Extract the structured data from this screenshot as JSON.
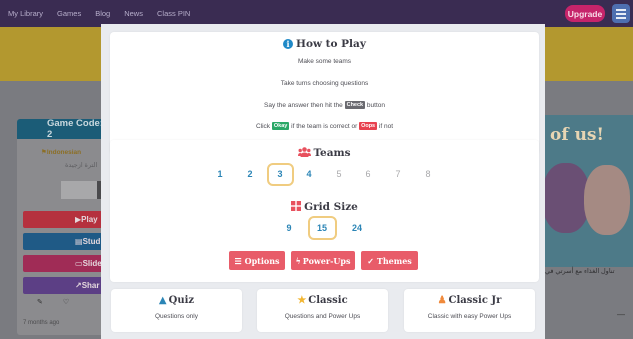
{
  "bg": {
    "nav_links": [
      "My Library",
      "Games",
      "Blog",
      "News",
      "Class PIN"
    ],
    "upgrade": "Upgrade",
    "card": {
      "title": "Game Code: 2",
      "lang": "Indonesian",
      "arabic": "الترة ازجيدة",
      "buttons": [
        {
          "label": "Play",
          "color": "#b5313e"
        },
        {
          "label": "Stud",
          "color": "#1f5a86"
        },
        {
          "label": "Slides",
          "color": "#a02c56"
        },
        {
          "label": "Shar",
          "color": "#5c3f85"
        }
      ],
      "time": "7 months ago"
    },
    "promo_text": "of us!",
    "promo_arabic": "تناول الغذاء مع أسرتي في"
  },
  "how_to_play": {
    "title": "How to Play",
    "line1": "Make some teams",
    "line2": "Take turns choosing questions",
    "line3_pre": "Say the answer then hit the",
    "check_tag": "Check",
    "line3_post": "button",
    "line4_pre": "Click",
    "okay_tag": "Okay",
    "line4_mid": "if the team is correct or",
    "oops_tag": "Oops",
    "line4_post": "if not"
  },
  "teams": {
    "title": "Teams",
    "options": [
      "1",
      "2",
      "3",
      "4",
      "5",
      "6",
      "7",
      "8"
    ],
    "selected": "3"
  },
  "grid_size": {
    "title": "Grid Size",
    "options": [
      "9",
      "15",
      "24"
    ],
    "selected": "15"
  },
  "buttons": {
    "options": "Options",
    "powerups": "Power-Ups",
    "themes": "Themes"
  },
  "modes": [
    {
      "title": "Quiz",
      "desc": "Questions only"
    },
    {
      "title": "Classic",
      "desc": "Questions and Power Ups"
    },
    {
      "title": "Classic Jr",
      "desc": "Classic with easy Power Ups"
    }
  ],
  "colors": {
    "accent_blue": "#2b85b6",
    "button_red": "#e85c69",
    "select_outline": "#f0cc80",
    "check_tag": "#6a6a70",
    "okay_tag": "#2aa867",
    "oops_tag": "#e8424f"
  }
}
